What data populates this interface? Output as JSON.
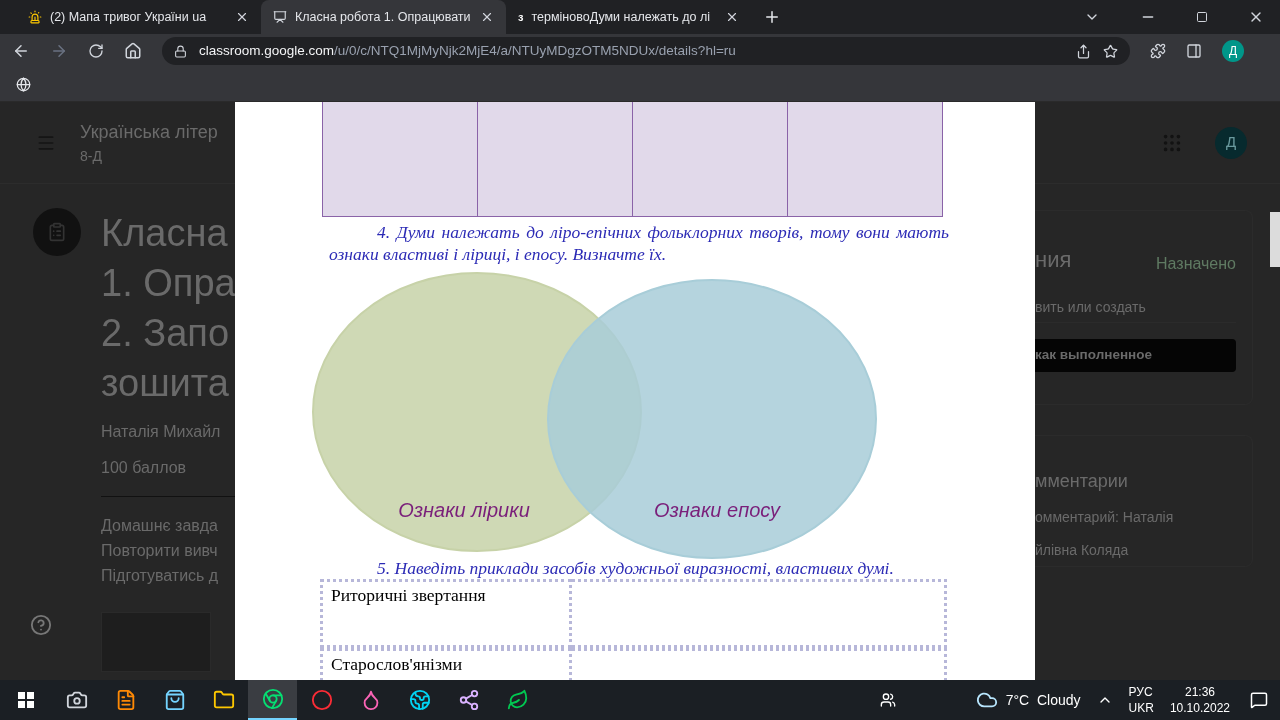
{
  "tabs": [
    {
      "title": "(2) Мапа тривог України uа",
      "selected": false,
      "kind": "alert"
    },
    {
      "title": "Класна робота 1. Опрацювати",
      "selected": true,
      "kind": "classroom"
    },
    {
      "title": "терміновоДуми належать до лі",
      "selected": false,
      "kind": "letter",
      "favicon_letter": "з"
    }
  ],
  "address": {
    "host": "classroom.google.com",
    "path": "/u/0/c/NTQ1MjMyNjk2MjE4/a/NTUyMDgzOTM5NDUx/details?hl=ru"
  },
  "profile_letter": "Д",
  "classroom": {
    "course": "Українська літер",
    "section": "8-Д",
    "avatar": "Д",
    "title_lines": [
      "Класна",
      "1. Опра",
      "2. Запо",
      "зошита"
    ],
    "teacher": "Наталія Михайл",
    "points": "100 баллов",
    "description_lines": [
      "Домашнє завда",
      "Повторити вивч",
      "Підготуватись д"
    ],
    "work_heading": "ния",
    "work_status": "Назначено",
    "add_button": "вить или создать",
    "done_button": "как выполненное",
    "comments_heading": "мментарии",
    "comment_lines": [
      "омментарий: Наталія",
      "йлівна Коляда"
    ]
  },
  "document": {
    "question_4": "4. Думи належать до ліро-епічних фольклорних  творів,  тому вони мають ознаки властиві і ліриці, і епосу. Визначте їх.",
    "venn": [
      {
        "label": "Ознаки лірики",
        "color": "#c7d2a8"
      },
      {
        "label": "Ознаки епосу",
        "color": "#a8cdd8"
      }
    ],
    "question_5": "5. Наведіть приклади засобів художньої виразності, властивих думі.",
    "rows": [
      {
        "label": "Риторичні звертання"
      },
      {
        "label": "Старослов'янізми"
      }
    ]
  },
  "taskbar": {
    "apps": [
      {
        "kind": "camera",
        "active": false
      },
      {
        "kind": "pdf",
        "active": false
      },
      {
        "kind": "store",
        "active": false
      },
      {
        "kind": "folder",
        "active": false
      },
      {
        "kind": "chrome",
        "active": true
      },
      {
        "kind": "opera",
        "active": false
      },
      {
        "kind": "drop",
        "active": false
      },
      {
        "kind": "edge",
        "active": false
      },
      {
        "kind": "graph",
        "active": false
      },
      {
        "kind": "green",
        "active": false
      }
    ],
    "weather": "7°C  Cloudy",
    "lang_top": "РУС",
    "lang_bottom": "UKR",
    "time": "21:36",
    "date": "10.10.2022"
  }
}
